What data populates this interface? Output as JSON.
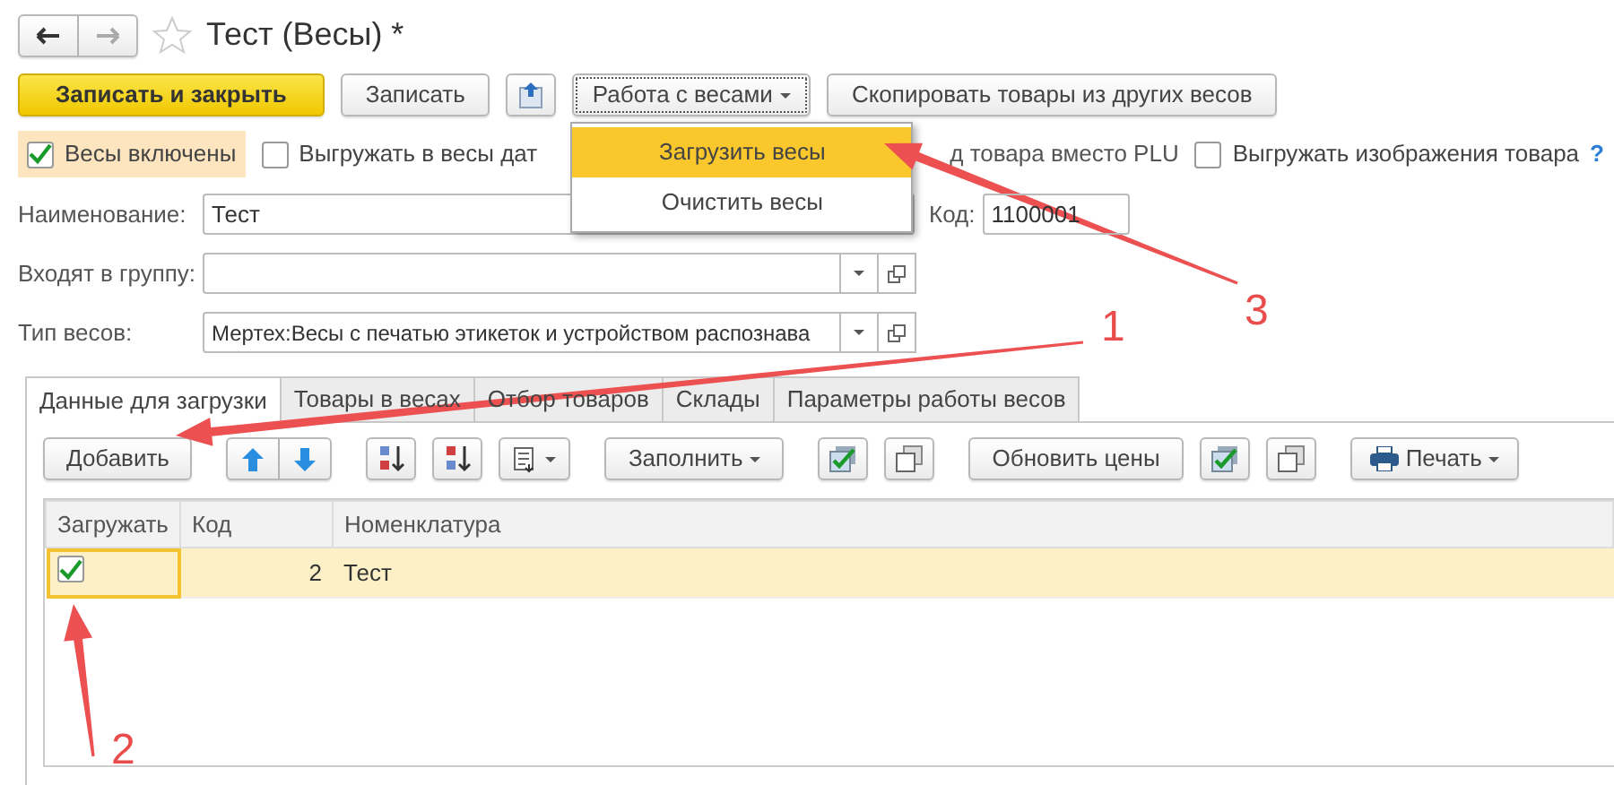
{
  "window": {
    "title": "Тест (Весы) *"
  },
  "commands": [
    {
      "kind": "primary",
      "label": "Записать и закрыть"
    },
    {
      "kind": "button",
      "label": "Записать"
    },
    {
      "kind": "upload"
    },
    {
      "kind": "menu",
      "label": "Работа с весами",
      "expanded": true
    },
    {
      "kind": "button",
      "label": "Скопировать товары из других весов"
    }
  ],
  "menu": [
    {
      "label": "Загрузить весы",
      "selected": true
    },
    {
      "label": "Очистить весы",
      "selected": false
    }
  ],
  "options": [
    {
      "kind": "checkbox",
      "label": "Весы включены",
      "checked": true,
      "focused": true
    },
    {
      "kind": "checkbox",
      "label": "Выгружать в весы дат",
      "checked": false,
      "focused": false
    },
    {
      "kind": "fragment",
      "label": "д товара вместо PLU"
    },
    {
      "kind": "checkbox",
      "label": "Выгружать изображения товара",
      "checked": false,
      "focused": false,
      "help": "?"
    }
  ],
  "fields": [
    {
      "kind": "text",
      "label": "Наименование:",
      "value": "Тест"
    },
    {
      "kind": "code",
      "label": "Код:",
      "value": "1100001"
    },
    {
      "kind": "choice",
      "label": "Входят в группу:"
    },
    {
      "kind": "choice",
      "label": "Тип весов:",
      "value": "Мертех:Весы с печатью этикеток и устройством распознава"
    }
  ],
  "tabs": [
    {
      "label": "Данные для загрузки",
      "selected": true
    },
    {
      "label": "Товары в весах",
      "selected": false
    },
    {
      "label": "Отбор товаров",
      "selected": false
    },
    {
      "label": "Склады",
      "selected": false
    },
    {
      "label": "Параметры работы весов",
      "selected": false
    }
  ],
  "toolbar": [
    {
      "kind": "button",
      "label": "Добавить"
    },
    {
      "kind": "updown"
    },
    {
      "kind": "sort-asc"
    },
    {
      "kind": "sort-desc"
    },
    {
      "kind": "list-menu"
    },
    {
      "kind": "menu",
      "label": "Заполнить"
    },
    {
      "kind": "check-all"
    },
    {
      "kind": "squares"
    },
    {
      "kind": "button",
      "label": "Обновить цены"
    },
    {
      "kind": "check-all"
    },
    {
      "kind": "squares"
    },
    {
      "kind": "print",
      "label": "Печать"
    }
  ],
  "table": {
    "columns": [
      "Загружать",
      "Код",
      "Номенклатура"
    ],
    "rows": [
      {
        "load": true,
        "code": "2",
        "name": "Тест",
        "selected": true
      }
    ]
  },
  "annotations": [
    {
      "label": "3"
    },
    {
      "label": "1"
    },
    {
      "label": "2"
    }
  ]
}
